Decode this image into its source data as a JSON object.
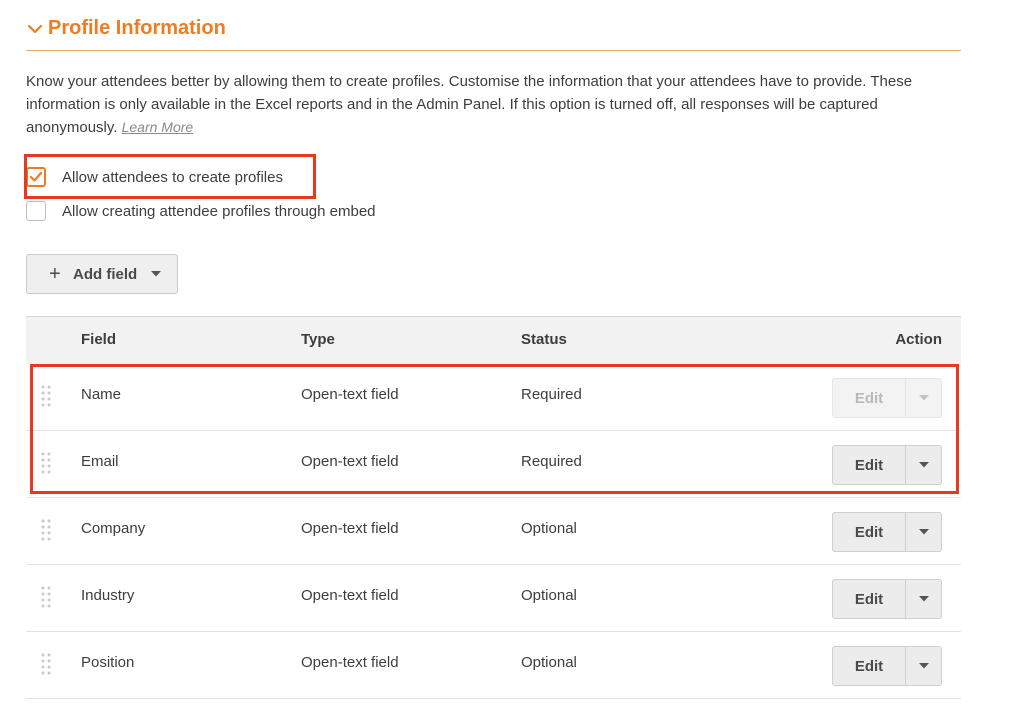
{
  "section": {
    "title": "Profile Information",
    "expand_icon": "chevron-down-icon"
  },
  "description": {
    "text": "Know your attendees better by allowing them to create profiles. Customise the information that your attendees have to provide. These information is only available in the Excel reports and in the Admin Panel. If this option is turned off, all responses will be captured anonymously.",
    "link": "Learn More"
  },
  "options": [
    {
      "label": "Allow attendees to create profiles",
      "checked": true
    },
    {
      "label": "Allow creating attendee profiles through embed",
      "checked": false
    }
  ],
  "add_field": {
    "label": "Add field",
    "icon": "plus-icon",
    "dropdown_icon": "caret-down-icon"
  },
  "table": {
    "headers": {
      "field": "Field",
      "type": "Type",
      "status": "Status",
      "action": "Action"
    },
    "rows": [
      {
        "field": "Name",
        "type": "Open-text field",
        "status": "Required",
        "action": "Edit",
        "disabled": true
      },
      {
        "field": "Email",
        "type": "Open-text field",
        "status": "Required",
        "action": "Edit",
        "disabled": false
      },
      {
        "field": "Company",
        "type": "Open-text field",
        "status": "Optional",
        "action": "Edit",
        "disabled": false
      },
      {
        "field": "Industry",
        "type": "Open-text field",
        "status": "Optional",
        "action": "Edit",
        "disabled": false
      },
      {
        "field": "Position",
        "type": "Open-text field",
        "status": "Optional",
        "action": "Edit",
        "disabled": false
      }
    ]
  },
  "colors": {
    "accent": "#ef7c22",
    "highlight": "#e53a1f"
  }
}
